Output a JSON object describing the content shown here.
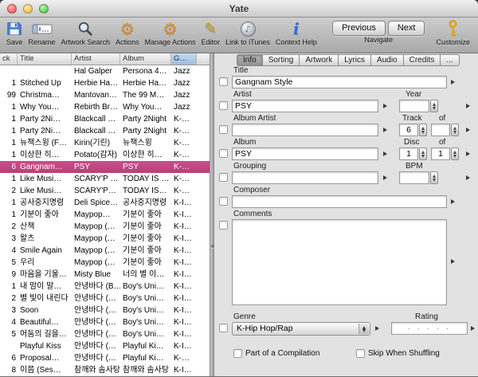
{
  "window": {
    "title": "Yate"
  },
  "colors": {
    "selection": "#c94f8c",
    "sorthl": "#c6daf0"
  },
  "glyphs": {
    "gear": "⚙",
    "pencil": "✎",
    "info": "i",
    "note": "♪"
  },
  "toolbar": {
    "items": [
      {
        "label": "Save",
        "icon": "save-floppy-icon"
      },
      {
        "label": "Rename",
        "icon": "rename-field-icon"
      },
      {
        "label": "Artwork Search",
        "icon": "magnifier-icon"
      },
      {
        "label": "Actions",
        "icon": "gear-icon"
      },
      {
        "label": "Manage Actions",
        "icon": "gear-icon"
      },
      {
        "label": "Editor",
        "icon": "pencil-icon"
      },
      {
        "label": "Link to iTunes",
        "icon": "itunes-disc-icon"
      },
      {
        "label": "Context Help",
        "icon": "info-icon"
      }
    ],
    "navigate": {
      "previous": "Previous",
      "next": "Next",
      "label": "Navigate"
    },
    "customize": {
      "label": "Customize",
      "icon": "key-icon"
    }
  },
  "table": {
    "columns": [
      "ck",
      "Title",
      "Artist",
      "Album",
      "G…"
    ],
    "sorted_column": "G…",
    "rows": [
      {
        "track": "",
        "title": "",
        "artist": "Hal Galper",
        "album": "Persona 4…",
        "genre": "Jazz"
      },
      {
        "track": "1",
        "title": "Stitched Up",
        "artist": "Herbie Ha…",
        "album": "Herbie Ha…",
        "genre": "Jazz"
      },
      {
        "track": "99",
        "title": "Christma…",
        "artist": "Mantovan…",
        "album": "The 99 M…",
        "genre": "Jazz"
      },
      {
        "track": "1",
        "title": "Why You…",
        "artist": "Rebirth Br…",
        "album": "Why You…",
        "genre": "Jazz"
      },
      {
        "track": "1",
        "title": "Party 2Ni…",
        "artist": "Blackcall …",
        "album": "Party 2Night",
        "genre": "K-…"
      },
      {
        "track": "1",
        "title": "Party 2Ni…",
        "artist": "Blackcall …",
        "album": "Party 2Night",
        "genre": "K-…"
      },
      {
        "track": "1",
        "title": "뉴잭스윙 (F…",
        "artist": "Kirin(기린)",
        "album": "뉴잭스윙",
        "genre": "K-…"
      },
      {
        "track": "1",
        "title": "이상한 히…",
        "artist": "Potato(감자)",
        "album": "이상한 히…",
        "genre": "K-…"
      },
      {
        "track": "6",
        "title": "Gangnam…",
        "artist": "PSY",
        "album": "PSY",
        "genre": "K-…",
        "selected": true
      },
      {
        "track": "1",
        "title": "Like Musi…",
        "artist": "SCARY'P …",
        "album": "TODAY IS …",
        "genre": "K-…"
      },
      {
        "track": "2",
        "title": "Like Musi…",
        "artist": "SCARY'P…",
        "album": "TODAY IS…",
        "genre": "K-…"
      },
      {
        "track": "1",
        "title": "공사중지명령",
        "artist": "Deli Spice…",
        "album": "공사중지명령",
        "genre": "K-I…"
      },
      {
        "track": "1",
        "title": "기분이 좋아",
        "artist": "Maypop…",
        "album": "기분이 좋아",
        "genre": "K-I…"
      },
      {
        "track": "2",
        "title": "산책",
        "artist": "Maypop (…",
        "album": "기분이 좋아",
        "genre": "K-I…"
      },
      {
        "track": "3",
        "title": "왈츠",
        "artist": "Maypop (…",
        "album": "기분이 좋아",
        "genre": "K-I…"
      },
      {
        "track": "4",
        "title": "Smile Again",
        "artist": "Maypop (…",
        "album": "기분이 좋아",
        "genre": "K-I…"
      },
      {
        "track": "5",
        "title": "우리",
        "artist": "Maypop (…",
        "album": "기분이 좋아",
        "genre": "K-I…"
      },
      {
        "track": "9",
        "title": "마음을 기울…",
        "artist": "Misty Blue",
        "album": "너의 별 이…",
        "genre": "K-I…"
      },
      {
        "track": "1",
        "title": "내 맘이 말…",
        "artist": "안녕바다 (B…",
        "album": "Boy's Uni…",
        "genre": "K-I…"
      },
      {
        "track": "2",
        "title": "별 빛이 내린다",
        "artist": "안녕바다 (…",
        "album": "Boy's Uni…",
        "genre": "K-I…"
      },
      {
        "track": "3",
        "title": "Soon",
        "artist": "안녕바다 (…",
        "album": "Boy's Uni…",
        "genre": "K-I…"
      },
      {
        "track": "4",
        "title": "Beautiful…",
        "artist": "안녕바다 (…",
        "album": "Boy's Uni…",
        "genre": "K-I…"
      },
      {
        "track": "5",
        "title": "어둠의 길을…",
        "artist": "안녕바다 (…",
        "album": "Boy's Uni…",
        "genre": "K-I…"
      },
      {
        "track": "",
        "title": "Playful Kiss",
        "artist": "안녕바다 (…",
        "album": "Playful Ki…",
        "genre": "K-I…"
      },
      {
        "track": "6",
        "title": "Proposal…",
        "artist": "안녕바다 (…",
        "album": "Playful Ki…",
        "genre": "K-…"
      },
      {
        "track": "8",
        "title": "이쯤 (Ses…",
        "artist": "참깨와 솜사탕",
        "album": "참깨와 솜사탕",
        "genre": "K-I…"
      }
    ]
  },
  "editor": {
    "tabs": [
      "Info",
      "Sorting",
      "Artwork",
      "Lyrics",
      "Audio",
      "Credits",
      "..."
    ],
    "active_tab": "Info",
    "fields": {
      "title": {
        "label": "Title",
        "value": "Gangnam Style"
      },
      "artist": {
        "label": "Artist",
        "value": "PSY"
      },
      "year": {
        "label": "Year",
        "value": ""
      },
      "album_artist": {
        "label": "Album Artist",
        "value": ""
      },
      "track": {
        "label": "Track",
        "value": "6",
        "of_label": "of",
        "of_value": ""
      },
      "album": {
        "label": "Album",
        "value": "PSY"
      },
      "disc": {
        "label": "Disc",
        "value": "1",
        "of_label": "of",
        "of_value": "1"
      },
      "grouping": {
        "label": "Grouping",
        "value": ""
      },
      "bpm": {
        "label": "BPM",
        "value": ""
      },
      "composer": {
        "label": "Composer",
        "value": ""
      },
      "comments": {
        "label": "Comments",
        "value": ""
      },
      "genre": {
        "label": "Genre",
        "value": "K-Hip Hop/Rap"
      },
      "rating": {
        "label": "Rating",
        "dots": "· · · · ·"
      }
    },
    "compilation_label": "Part of a Compilation",
    "skip_label": "Skip When Shuffling"
  }
}
